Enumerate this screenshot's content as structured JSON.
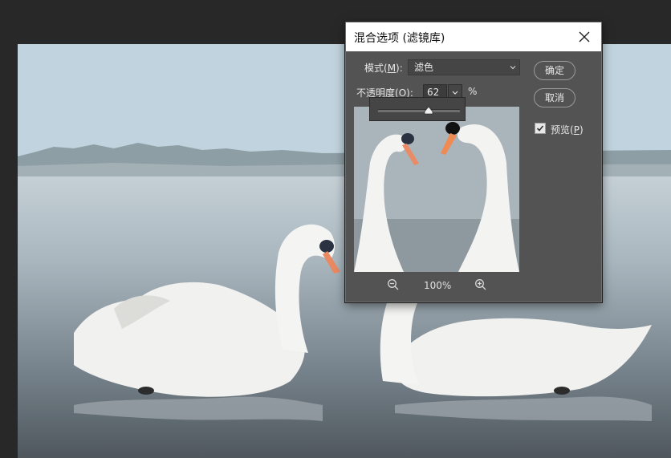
{
  "dialog": {
    "title": "混合选项 (滤镜库)",
    "mode_label_prefix": "模式(",
    "mode_label_key": "M",
    "mode_label_suffix": "):",
    "mode_value": "滤色",
    "opacity_label_prefix": "不透明度(",
    "opacity_label_key": "O",
    "opacity_label_suffix": "):",
    "opacity_value": "62",
    "opacity_unit": "%",
    "opacity_slider_level": 0.62,
    "ok_label": "确定",
    "cancel_label": "取消",
    "preview_label_prefix": "预览(",
    "preview_label_key": "P",
    "preview_label_suffix": ")",
    "preview_checked": true,
    "zoom_level": "100%"
  },
  "colors": {
    "app_background": "#282828",
    "dialog_background": "#535353",
    "title_bar": "#ffffff"
  },
  "icons": [
    "close-icon",
    "chevron-down-icon",
    "zoom-out-icon",
    "zoom-in-icon",
    "checkmark-icon"
  ]
}
